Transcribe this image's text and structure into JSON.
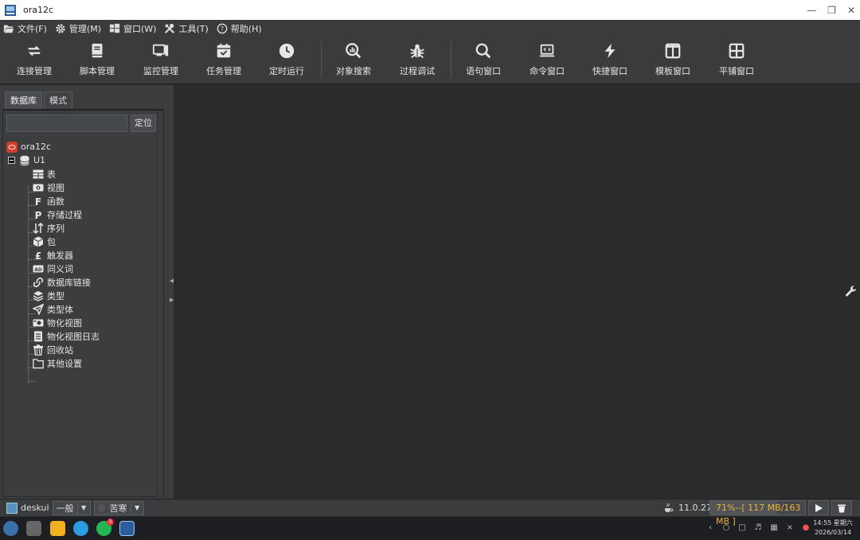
{
  "window": {
    "title": "ora12c"
  },
  "menu": [
    {
      "label": "文件(F)",
      "icon": "folder-open-icon"
    },
    {
      "label": "管理(M)",
      "icon": "gear-icon"
    },
    {
      "label": "窗口(W)",
      "icon": "windows-icon"
    },
    {
      "label": "工具(T)",
      "icon": "tools-icon"
    },
    {
      "label": "帮助(H)",
      "icon": "help-icon"
    }
  ],
  "toolbar": [
    {
      "label": "连接管理",
      "icon": "refresh-arrows-icon"
    },
    {
      "label": "脚本管理",
      "icon": "book-icon"
    },
    {
      "label": "监控管理",
      "icon": "monitor-icon"
    },
    {
      "label": "任务管理",
      "icon": "calendar-check-icon"
    },
    {
      "label": "定时运行",
      "icon": "clock-icon"
    },
    {
      "label": "对象搜索",
      "icon": "search-chart-icon"
    },
    {
      "label": "过程调试",
      "icon": "bug-icon"
    },
    {
      "label": "语句窗口",
      "icon": "search-icon"
    },
    {
      "label": "命令窗口",
      "icon": "laptop-code-icon"
    },
    {
      "label": "快捷窗口",
      "icon": "lightning-icon"
    },
    {
      "label": "模板窗口",
      "icon": "columns-icon"
    },
    {
      "label": "平铺窗口",
      "icon": "grid-icon"
    }
  ],
  "left_panel": {
    "tabs": [
      "数据库",
      "模式"
    ],
    "search": {
      "value": "",
      "placeholder": ""
    },
    "locate_label": "定位",
    "root": "ora12c",
    "schema": "U1",
    "items": [
      "表",
      "视图",
      "函数",
      "存储过程",
      "序列",
      "包",
      "触发器",
      "同义词",
      "数据库链接",
      "类型",
      "类型体",
      "物化视图",
      "物化视图日志",
      "回收站",
      "其他设置"
    ]
  },
  "status": {
    "user": "deskui",
    "mode": "一般",
    "theme": "苦寒",
    "version": "11.0.27",
    "memory_text": "71%--[ 117 MB/163 MB ]",
    "memory_percent": 71
  },
  "taskbar": {
    "time": "14:55 星期六",
    "date": "2026/03/14",
    "badge": "3"
  },
  "colors": {
    "accent_orange": "#e9b43a",
    "root_red": "#d33b2e",
    "bg_dark": "#2b2b2b",
    "panel": "#3b3d3f"
  }
}
